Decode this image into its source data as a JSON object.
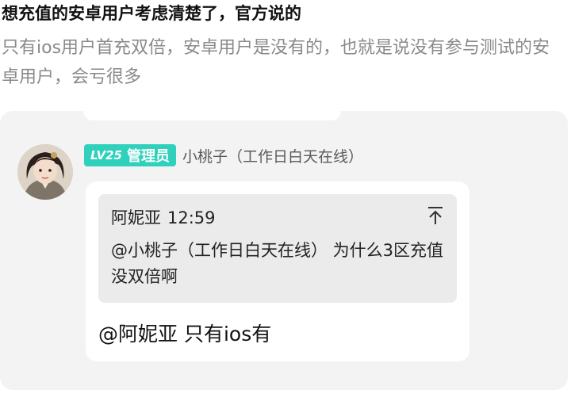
{
  "post": {
    "title": "想充值的安卓用户考虑清楚了，官方说的",
    "body": "只有ios用户首充双倍，安卓用户是没有的，也就是说没有参与测试的安卓用户，会亏很多"
  },
  "screenshot": {
    "author": {
      "level": "LV25",
      "role": "管理员",
      "name": "小桃子（工作日白天在线）",
      "badge_color": "#2fd1bd"
    },
    "reply_to": {
      "name": "阿妮亚",
      "time": "12:59",
      "icon": "pin-icon",
      "text": "@小桃子（工作日白天在线） 为什么3区充值没双倍啊"
    },
    "message": "@阿妮亚 只有ios有"
  }
}
